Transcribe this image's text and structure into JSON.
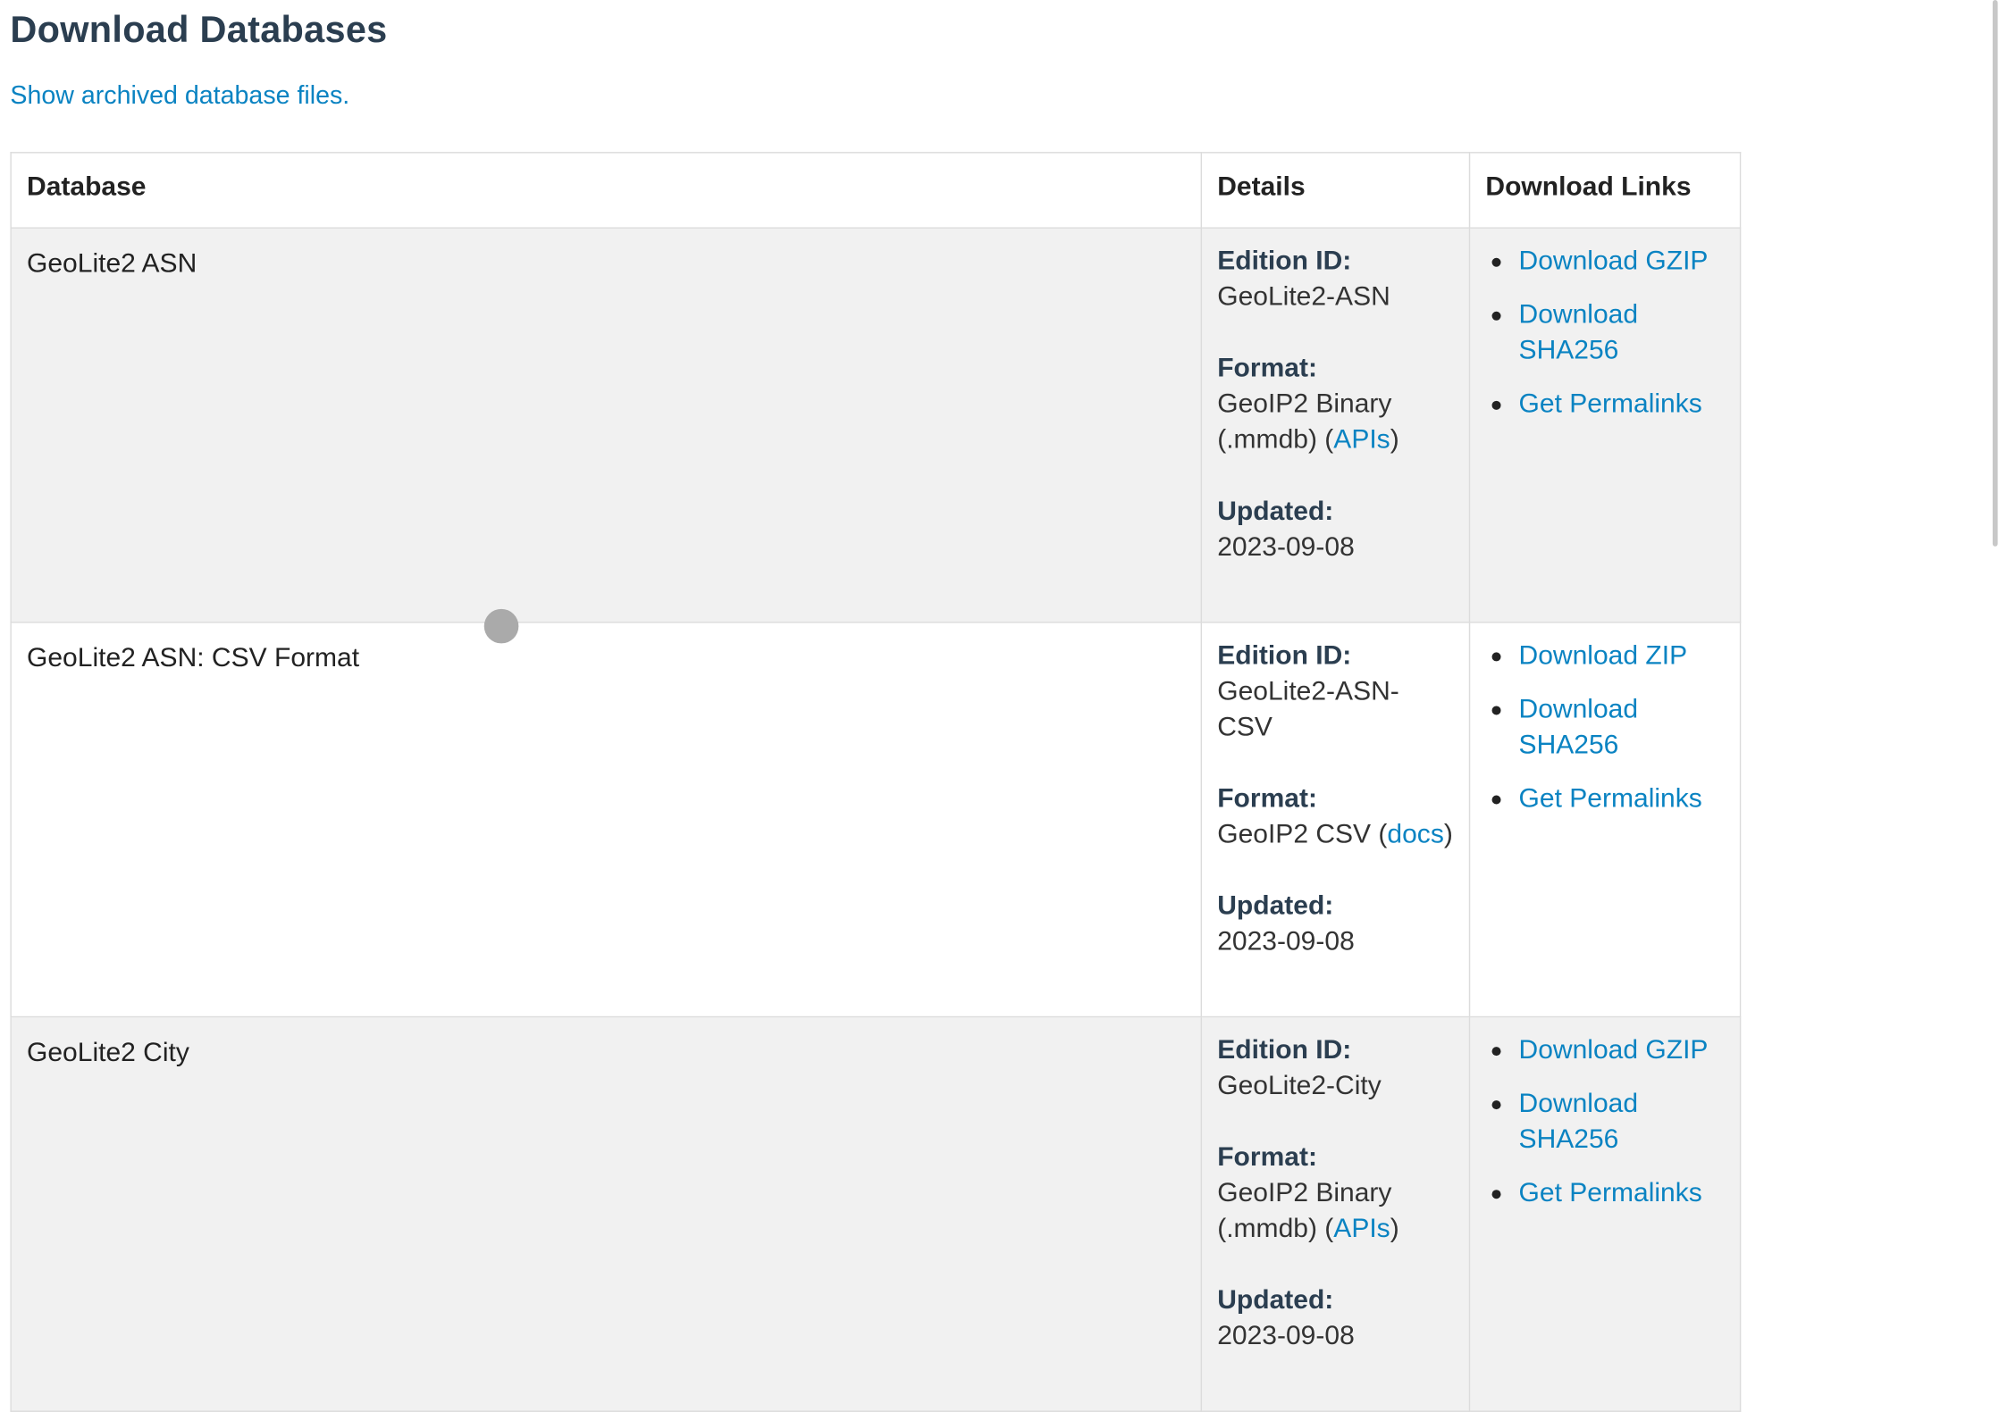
{
  "page": {
    "title": "Download Databases",
    "archive_link": "Show archived database files."
  },
  "table": {
    "headers": {
      "database": "Database",
      "details": "Details",
      "links": "Download Links"
    },
    "labels": {
      "edition": "Edition ID:",
      "format": "Format:",
      "updated": "Updated:"
    },
    "rows": [
      {
        "name": "GeoLite2 ASN",
        "edition_id": "GeoLite2-ASN",
        "format_text": "GeoIP2 Binary (.mmdb)",
        "format_link": "APIs",
        "updated": "2023-09-08",
        "links": [
          "Download GZIP",
          "Download SHA256",
          "Get Permalinks"
        ]
      },
      {
        "name": "GeoLite2 ASN: CSV Format",
        "edition_id": "GeoLite2-ASN-CSV",
        "format_text": "GeoIP2 CSV",
        "format_link": "docs",
        "updated": "2023-09-08",
        "links": [
          "Download ZIP",
          "Download SHA256",
          "Get Permalinks"
        ]
      },
      {
        "name": "GeoLite2 City",
        "edition_id": "GeoLite2-City",
        "format_text": "GeoIP2 Binary (.mmdb)",
        "format_link": "APIs",
        "updated": "2023-09-08",
        "links": [
          "Download GZIP",
          "Download SHA256",
          "Get Permalinks"
        ]
      }
    ]
  },
  "colors": {
    "title": "#2b3e50",
    "link": "#0a83c2",
    "row_shade": "#f1f1f1",
    "border": "#dcdcdc"
  }
}
